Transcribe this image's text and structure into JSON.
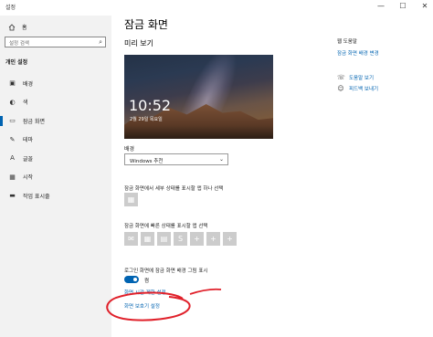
{
  "window": {
    "title": "설정",
    "minimize": "—",
    "maximize": "☐",
    "close": "✕"
  },
  "sidebar": {
    "home_icon": "home-icon",
    "home_label": "홈",
    "search_placeholder": "설정 검색",
    "section_title": "개인 설정",
    "items": [
      {
        "icon": "image-icon",
        "glyph": "▣",
        "label": "배경"
      },
      {
        "icon": "palette-icon",
        "glyph": "◐",
        "label": "색"
      },
      {
        "icon": "lock-screen-icon",
        "glyph": "▭",
        "label": "잠금 화면"
      },
      {
        "icon": "brush-icon",
        "glyph": "✎",
        "label": "테마"
      },
      {
        "icon": "font-icon",
        "glyph": "A",
        "label": "글꼴"
      },
      {
        "icon": "start-icon",
        "glyph": "▦",
        "label": "시작"
      },
      {
        "icon": "taskbar-icon",
        "glyph": "▬",
        "label": "작업 표시줄"
      }
    ],
    "active_index": 2
  },
  "main": {
    "page_title": "잠금 화면",
    "preview_label": "미리 보기",
    "preview_time": "10:52",
    "preview_date": "2월 29일 목요일",
    "background_label": "배경",
    "background_value": "Windows 추천",
    "detail_label": "잠금 화면에서 세부 상태를 표시할 앱 하나 선택",
    "quick_label": "잠금 화면에 빠른 상태를 표시할 앱 선택",
    "signin_label": "로그인 화면에 잠금 화면 배경 그림 표시",
    "toggle_state": "켬",
    "link_timeout": "화면 시간 제한 설정",
    "link_screensaver": "화면 보호기 설정"
  },
  "right": {
    "web_help_title": "웹 도움말",
    "web_help_link": "잠금 화면 배경 변경",
    "help_link": "도움말 보기",
    "feedback_link": "피드백 보내기"
  },
  "colors": {
    "accent": "#0063b1",
    "annotation": "#e0202a",
    "sidebar_bg": "#f2f2f2",
    "tile": "#cccccc"
  }
}
